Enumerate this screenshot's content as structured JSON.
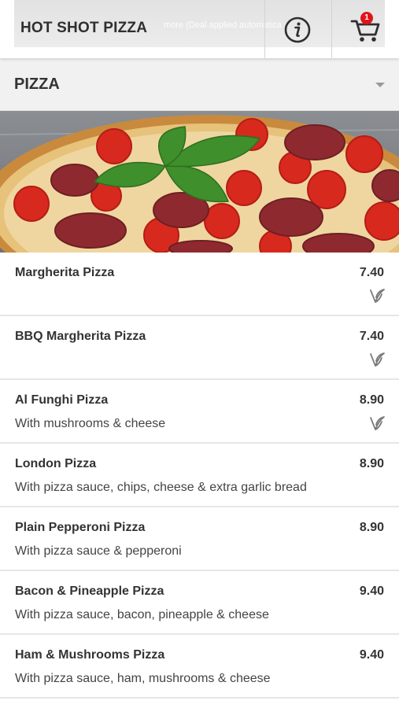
{
  "header": {
    "brand": "HOT SHOT PIZZA",
    "banner_text": "more (Deal applied automatica",
    "info_icon": "info-icon",
    "cart_icon": "shopping-cart-icon",
    "cart_count": "1",
    "badge_color": "#e0151b"
  },
  "category": {
    "title": "PIZZA",
    "chevron_icon": "chevron-down-icon"
  },
  "hero": {
    "alt": "pizza-photo"
  },
  "items": [
    {
      "name": "Margherita Pizza",
      "desc": "",
      "price": "7.40",
      "vegetarian": true
    },
    {
      "name": "BBQ Margherita Pizza",
      "desc": "",
      "price": "7.40",
      "vegetarian": true
    },
    {
      "name": "Al Funghi Pizza",
      "desc": "With mushrooms & cheese",
      "price": "8.90",
      "vegetarian": true
    },
    {
      "name": "London Pizza",
      "desc": "With pizza sauce, chips, cheese & extra garlic bread",
      "price": "8.90",
      "vegetarian": false
    },
    {
      "name": "Plain Pepperoni Pizza",
      "desc": "With pizza sauce & pepperoni",
      "price": "8.90",
      "vegetarian": false
    },
    {
      "name": "Bacon & Pineapple Pizza",
      "desc": "With pizza sauce, bacon, pineapple & cheese",
      "price": "9.40",
      "vegetarian": false
    },
    {
      "name": "Ham & Mushrooms Pizza",
      "desc": "With pizza sauce, ham, mushrooms & cheese",
      "price": "9.40",
      "vegetarian": false
    }
  ]
}
